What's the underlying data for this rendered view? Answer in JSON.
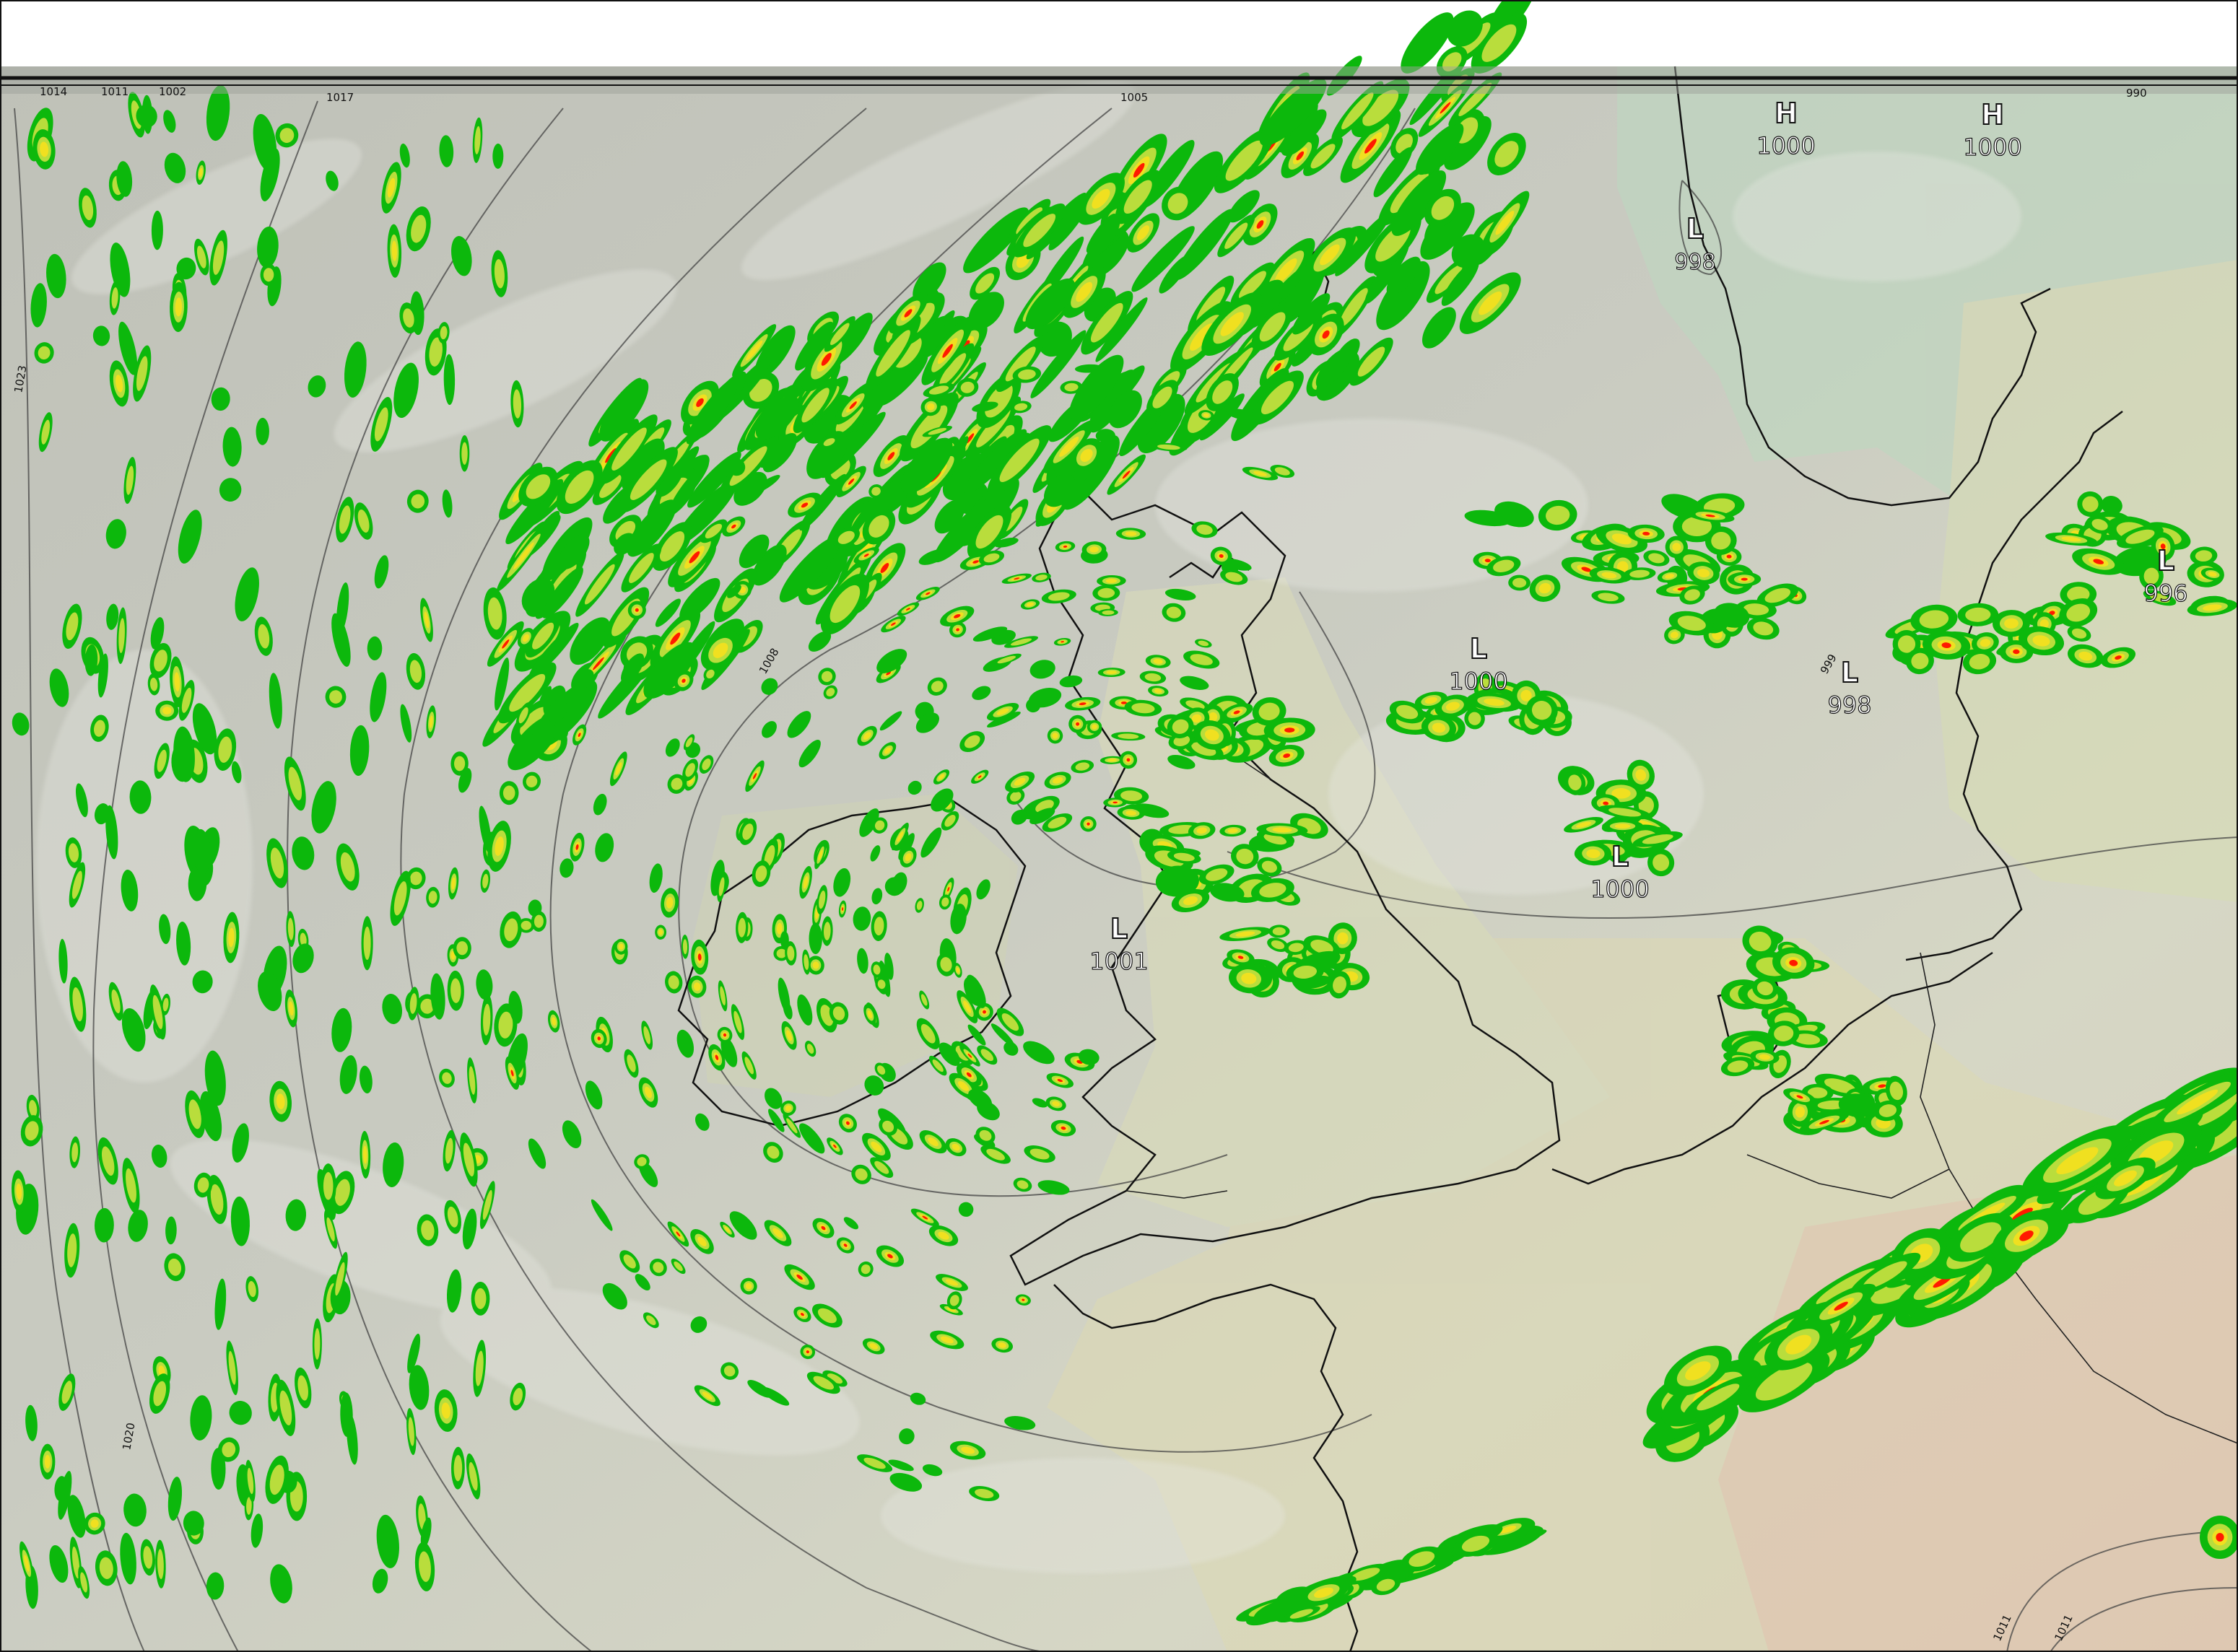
{
  "map": {
    "pressure_centers": [
      {
        "type": "H",
        "value": "1000"
      },
      {
        "type": "H",
        "value": "1000"
      },
      {
        "type": "L",
        "value": "998"
      },
      {
        "type": "L",
        "value": "996"
      },
      {
        "type": "L",
        "value": "998"
      },
      {
        "type": "L",
        "value": "1000"
      },
      {
        "type": "L",
        "value": "1000"
      },
      {
        "type": "L",
        "value": "1001"
      }
    ],
    "isobar_labels": [
      "1023",
      "1008",
      "1020",
      "1011",
      "1011",
      "1014",
      "1017",
      "999"
    ],
    "top_strip_labels": [
      "1014",
      "1011",
      "1002",
      "1017",
      "1005",
      "990"
    ],
    "colors": {
      "background_cloud": "#b9bcb1",
      "precip_light": "#0cb80c",
      "precip_moderate": "#b9dd3c",
      "precip_heavy": "#f0e020",
      "precip_intense": "#ff1a00",
      "coastline": "#111111",
      "isobar": "#444444"
    }
  }
}
